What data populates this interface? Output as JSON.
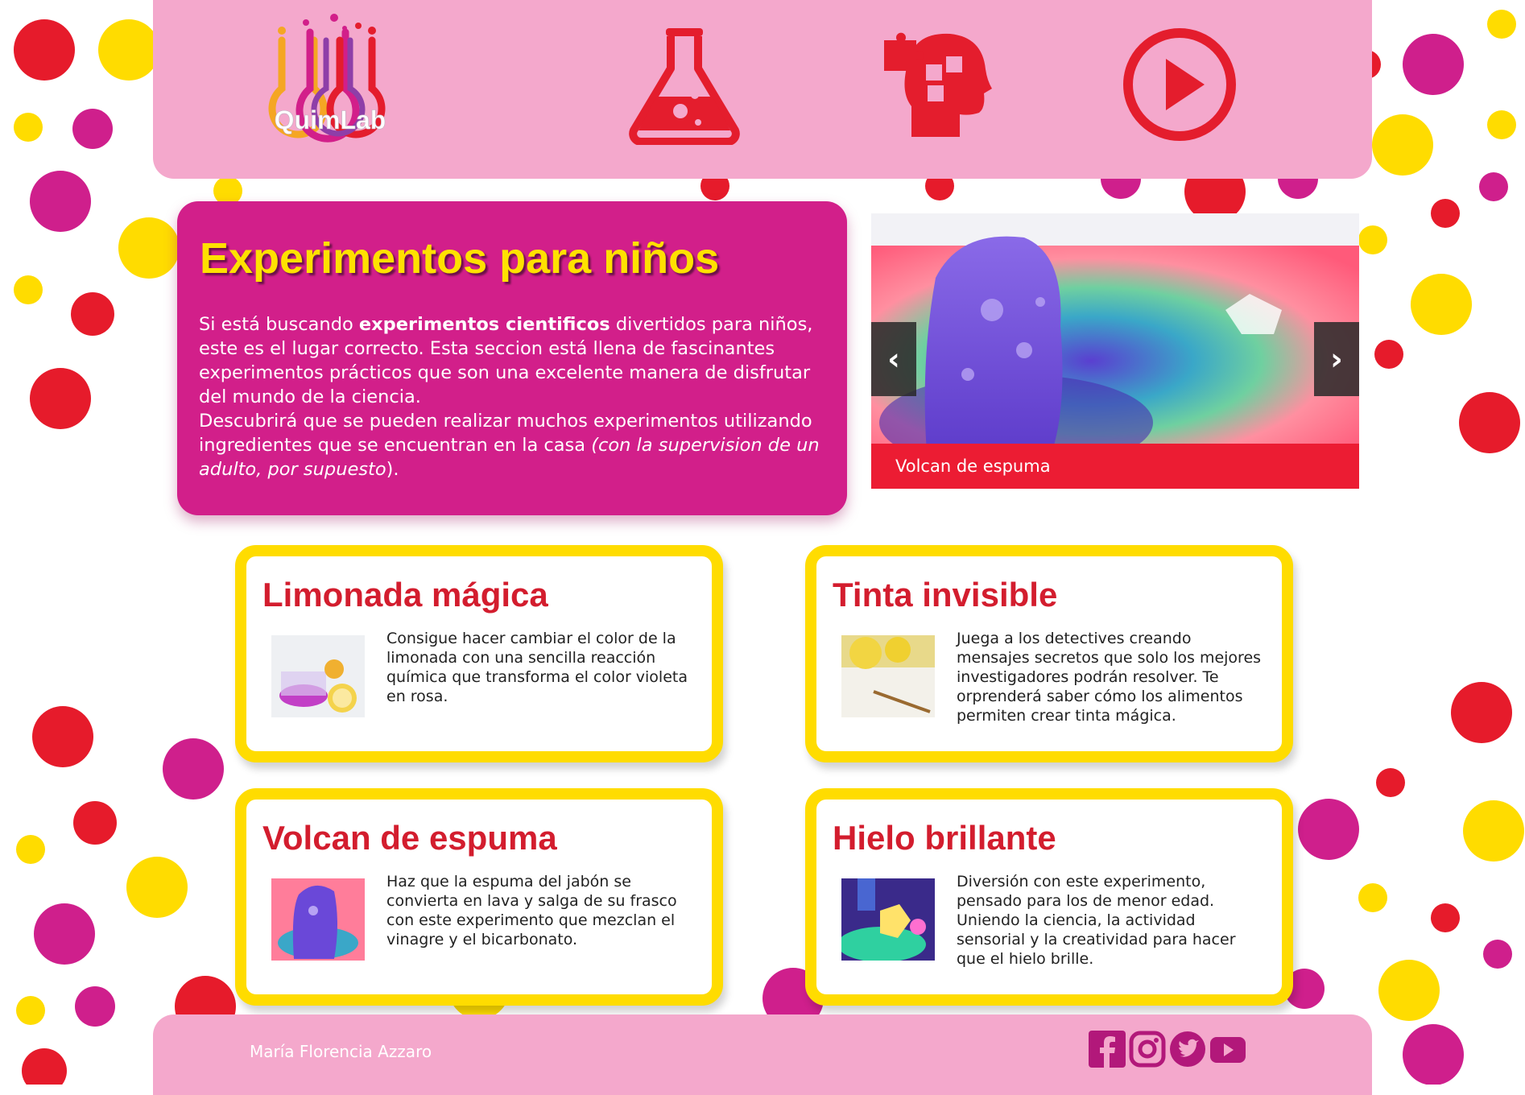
{
  "header": {
    "logo_text": "QuimLab",
    "icons": [
      "flask-icon",
      "puzzle-head-icon",
      "play-icon"
    ]
  },
  "intro": {
    "title": "Experimentos para niños",
    "p1_a": "Si está buscando ",
    "p1_bold": "experimentos cientificos",
    "p1_b": " divertidos para niños, este es el lugar correcto. Esta seccion está llena de fascinantes experimentos prácticos que son una excelente manera de disfrutar del mundo de la ciencia.",
    "p2_a": "Descubrirá que se pueden realizar muchos experimentos utilizando ingredientes que se encuentran en la casa ",
    "p2_italic": "(con la supervision de un adulto, por supuesto",
    "p2_b": ")."
  },
  "carousel": {
    "caption": "Volcan de espuma",
    "prev_label": "‹",
    "next_label": "›"
  },
  "cards": [
    {
      "title": "Limonada mágica",
      "text": "Consigue hacer cambiar el color de la limonada con una sencilla reacción química que transforma el color violeta en rosa."
    },
    {
      "title": "Tinta invisible",
      "text": "Juega a los detectives creando mensajes secretos que solo los mejores investigadores podrán resolver. Te orprenderá saber cómo los alimentos permiten crear tinta mágica."
    },
    {
      "title": "Volcan de espuma",
      "text": "Haz que la espuma del jabón se convierta en lava y salga de su frasco con este experimento que mezclan el vinagre y el bicarbonato."
    },
    {
      "title": "Hielo brillante",
      "text": "Diversión con este experimento, pensado para los de menor edad. Uniendo la ciencia, la actividad sensorial y la creatividad para hacer que el hielo brille."
    }
  ],
  "footer": {
    "author": "María Florencia Azzaro",
    "social": [
      "facebook-icon",
      "instagram-icon",
      "twitter-icon",
      "youtube-icon"
    ]
  },
  "colors": {
    "header_pink": "#f4a8cc",
    "magenta": "#d21f8a",
    "yellow": "#ffdc00",
    "red": "#e41d2d"
  }
}
